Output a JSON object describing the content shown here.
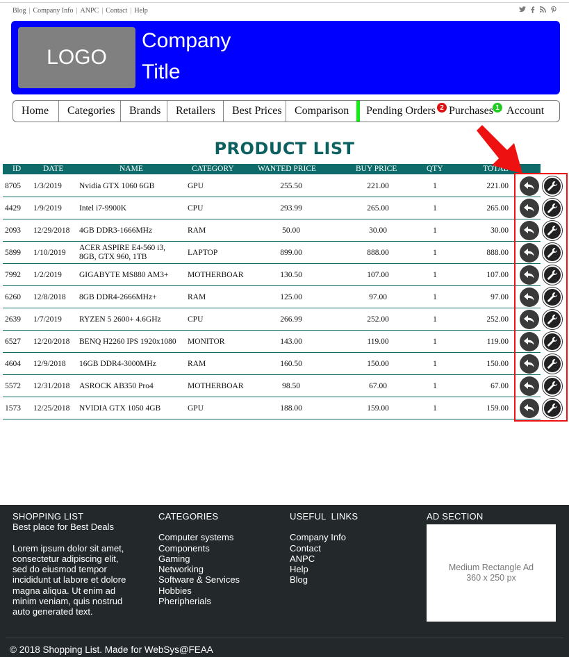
{
  "top_links": [
    "Blog",
    "Company Info",
    "ANPC",
    "Contact",
    "Help"
  ],
  "social_icons": [
    "twitter-icon",
    "facebook-icon",
    "rss-icon",
    "pinterest-icon"
  ],
  "header": {
    "logo": "LOGO",
    "title_line1": "Company",
    "title_line2": "Title",
    "color": "#0000ff"
  },
  "nav": {
    "items": [
      "Home",
      "Categories",
      "Brands",
      "Retailers",
      "Best Prices",
      "Comparison",
      "Pending Orders",
      "Purchases",
      "Account"
    ],
    "pending_badge": "2",
    "purchases_badge": "1"
  },
  "page_title": "PRODUCT LIST",
  "table": {
    "headers": {
      "id": "ID",
      "date": "DATE",
      "name": "NAME",
      "category": "CATEGORY",
      "wanted": "WANTED PRICE",
      "buy": "BUY PRICE",
      "qty": "QTY",
      "total": "TOTAL"
    },
    "rows": [
      {
        "id": "8705",
        "date": "1/3/2019",
        "name": "Nvidia GTX 1060 6GB",
        "category": "GPU",
        "wanted": "255.50",
        "buy": "221.00",
        "qty": "1",
        "total": "221.00"
      },
      {
        "id": "4429",
        "date": "1/9/2019",
        "name": "Intel i7-9900K",
        "category": "CPU",
        "wanted": "293.99",
        "buy": "265.00",
        "qty": "1",
        "total": "265.00"
      },
      {
        "id": "2093",
        "date": "12/29/2018",
        "name": "4GB DDR3-1666MHz",
        "category": "RAM",
        "wanted": "50.00",
        "buy": "30.00",
        "qty": "1",
        "total": "30.00"
      },
      {
        "id": "5899",
        "date": "1/10/2019",
        "name": "ACER ASPIRE E4-560 i3, 8GB, GTX 960, 1TB",
        "category": "LAPTOP",
        "wanted": "899.00",
        "buy": "888.00",
        "qty": "1",
        "total": "888.00"
      },
      {
        "id": "7992",
        "date": "1/2/2019",
        "name": "GIGABYTE MS880 AM3+",
        "category": "MOTHERBOAR",
        "wanted": "130.50",
        "buy": "107.00",
        "qty": "1",
        "total": "107.00"
      },
      {
        "id": "6260",
        "date": "12/8/2018",
        "name": "8GB DDR4-2666MHz+",
        "category": "RAM",
        "wanted": "125.00",
        "buy": "97.00",
        "qty": "1",
        "total": "97.00"
      },
      {
        "id": "2639",
        "date": "1/7/2019",
        "name": "RYZEN 5 2600+ 4.6GHz",
        "category": "CPU",
        "wanted": "266.99",
        "buy": "252.00",
        "qty": "1",
        "total": "252.00"
      },
      {
        "id": "6527",
        "date": "12/20/2018",
        "name": "BENQ H2260 IPS 1920x1080",
        "category": "MONITOR",
        "wanted": "143.00",
        "buy": "119.00",
        "qty": "1",
        "total": "119.00"
      },
      {
        "id": "4604",
        "date": "12/9/2018",
        "name": "16GB DDR4-3000MHz",
        "category": "RAM",
        "wanted": "160.50",
        "buy": "150.00",
        "qty": "1",
        "total": "150.00"
      },
      {
        "id": "5572",
        "date": "12/31/2018",
        "name": "ASROCK AB350 Pro4",
        "category": "MOTHERBOAR",
        "wanted": "98.50",
        "buy": "67.00",
        "qty": "1",
        "total": "67.00"
      },
      {
        "id": "1573",
        "date": "12/25/2018",
        "name": "NVIDIA GTX 1050 4GB",
        "category": "GPU",
        "wanted": "188.00",
        "buy": "159.00",
        "qty": "1",
        "total": "159.00"
      }
    ]
  },
  "footer": {
    "shop_title": "SHOPPING LIST",
    "shop_tagline": "Best place for Best Deals",
    "shop_text": [
      "Lorem ipsum dolor sit amet,",
      "consectetur adipiscing elit,",
      "sed do eiusmod tempor",
      "incididunt ut labore et dolore",
      "magna aliqua. Ut enim ad",
      "minim veniam, quis nostrud",
      "auto generated text."
    ],
    "categories_title": "CATEGORIES",
    "categories": [
      "Computer systems",
      "Components",
      "Gaming",
      "Networking",
      "Software & Services",
      "Hobbies",
      "Pheripherials"
    ],
    "links_title": "USEFUL  LINKS",
    "links": [
      "Company Info",
      "Contact",
      "ANPC",
      "Help",
      "Blog"
    ],
    "ad_title": "AD SECTION",
    "ad_line1": "Medium Rectangle Ad",
    "ad_line2": "360 x 250 px",
    "copyright": "© 2018 Shopping List. Made for WebSys@FEAA"
  }
}
